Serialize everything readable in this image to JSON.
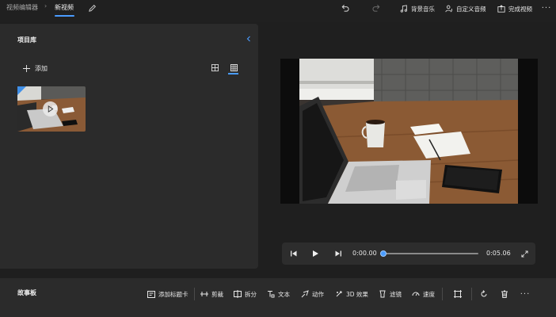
{
  "topbar": {
    "breadcrumb_root": "视频编辑器",
    "breadcrumb_current": "新视频",
    "background_music": "背景音乐",
    "custom_audio": "自定义音频",
    "finish_video": "完成视频"
  },
  "library": {
    "title": "项目库",
    "add_label": "添加"
  },
  "player": {
    "current_time": "0:00.00",
    "total_time": "0:05.06",
    "progress": 0
  },
  "storyboard": {
    "title": "故事板",
    "tools": {
      "add_title_card": "添加标题卡",
      "trim": "剪裁",
      "split": "拆分",
      "text": "文本",
      "motion": "动作",
      "effects_3d": "3D 效果",
      "filters": "滤镜",
      "speed": "速度"
    }
  },
  "colors": {
    "accent": "#4a9cff",
    "panel": "#2b2b2b",
    "background": "#1f1f1f"
  }
}
